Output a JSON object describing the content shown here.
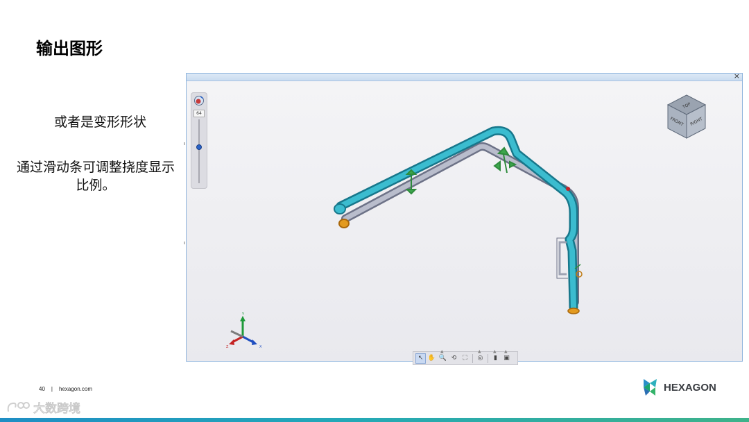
{
  "slide": {
    "title": "输出图形",
    "note_1": "或者是变形形状",
    "note_2": "通过滑动条可调整挠度显示比例。"
  },
  "viewer": {
    "close_label": "×",
    "scale_value": "64",
    "scale_level_fraction": 0.43,
    "view_cube": {
      "top": "TOP",
      "front": "FRONT",
      "right": "RIGHT"
    },
    "axes": {
      "x": "X",
      "y": "Y",
      "z": "Z"
    },
    "toolbar": [
      {
        "icon": "select-arrow-icon",
        "glyph": "↖",
        "active": true
      },
      {
        "icon": "pan-hand-icon",
        "glyph": "✋",
        "active": false
      },
      {
        "icon": "zoom-icon",
        "glyph": "🔍",
        "active": false,
        "caret": true
      },
      {
        "icon": "rotate-icon",
        "glyph": "⟲",
        "active": false
      },
      {
        "icon": "fit-all-icon",
        "glyph": "⛶",
        "active": false
      },
      {
        "icon": "view-orientation-icon",
        "glyph": "◎",
        "active": false,
        "caret": true
      },
      {
        "icon": "display-style-icon",
        "glyph": "▮",
        "active": false,
        "caret": true
      },
      {
        "icon": "visibility-icon",
        "glyph": "▣",
        "active": false,
        "caret": true
      }
    ],
    "colors": {
      "deformed_pipe": "#2fa8bd",
      "original_pipe": "#9ea3b3",
      "supports": "#2e8b3c",
      "end_cap": "#e39a1f"
    }
  },
  "footer": {
    "page_number": "40",
    "separator": "|",
    "site": "hexagon.com"
  },
  "brand": {
    "name": "HEXAGON",
    "watermark": "大数跨境",
    "bar_colors": [
      "#1f8ec4",
      "#3eb28a"
    ]
  }
}
